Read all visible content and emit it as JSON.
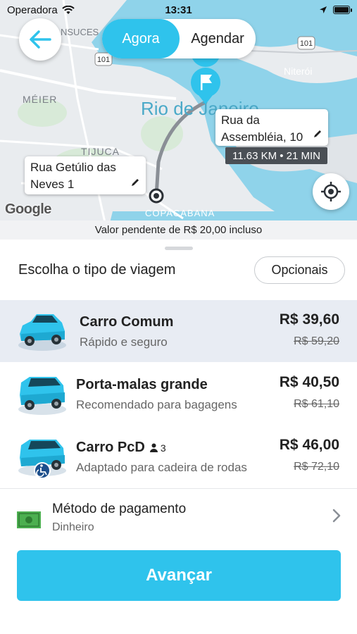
{
  "status_bar": {
    "carrier": "Operadora",
    "time": "13:31"
  },
  "map": {
    "labels": {
      "city": "Rio de Janeiro",
      "meier": "MÉIER",
      "tijuca": "TIJUCA",
      "copacabana": "COPACABANA",
      "niteroi": "Niterói",
      "consuces": "NSUCES",
      "road_101a": "101",
      "road_101b": "101"
    },
    "google_label": "Google"
  },
  "mode_toggle": {
    "active": "Agora",
    "inactive": "Agendar"
  },
  "route": {
    "destination": "Rua da Assembléia, 10",
    "origin": "Rua Getúlio das Neves 1",
    "distance_time": "11.63 KM • 21 MIN"
  },
  "pending_notice": "Valor pendente de R$ 20,00 incluso",
  "trip_section": {
    "title": "Escolha o tipo de viagem",
    "options_button": "Opcionais"
  },
  "rides": [
    {
      "name": "Carro Comum",
      "description": "Rápido e seguro",
      "price": "R$ 39,60",
      "old_price": "R$ 59,20",
      "selected": true
    },
    {
      "name": "Porta-malas grande",
      "description": "Recomendado para bagagens",
      "price": "R$ 40,50",
      "old_price": "R$ 61,10",
      "selected": false
    },
    {
      "name": "Carro PcD",
      "capacity": "3",
      "description": "Adaptado para cadeira de rodas",
      "price": "R$ 46,00",
      "old_price": "R$ 72,10",
      "selected": false
    }
  ],
  "payment": {
    "title": "Método de pagamento",
    "method": "Dinheiro"
  },
  "cta": {
    "label": "Avançar"
  },
  "colors": {
    "accent": "#2fc3ec",
    "water": "#8fd3ea",
    "land": "#e9ecef",
    "selected_row": "#e8ecf3"
  },
  "icons": [
    "back-arrow-icon",
    "wifi-icon",
    "location-arrow-icon",
    "battery-icon",
    "destination-flag-icon",
    "edit-pencil-icon",
    "origin-pin-icon",
    "locate-me-icon",
    "car-icon",
    "person-icon",
    "wheelchair-icon",
    "money-icon",
    "chevron-right-icon"
  ]
}
